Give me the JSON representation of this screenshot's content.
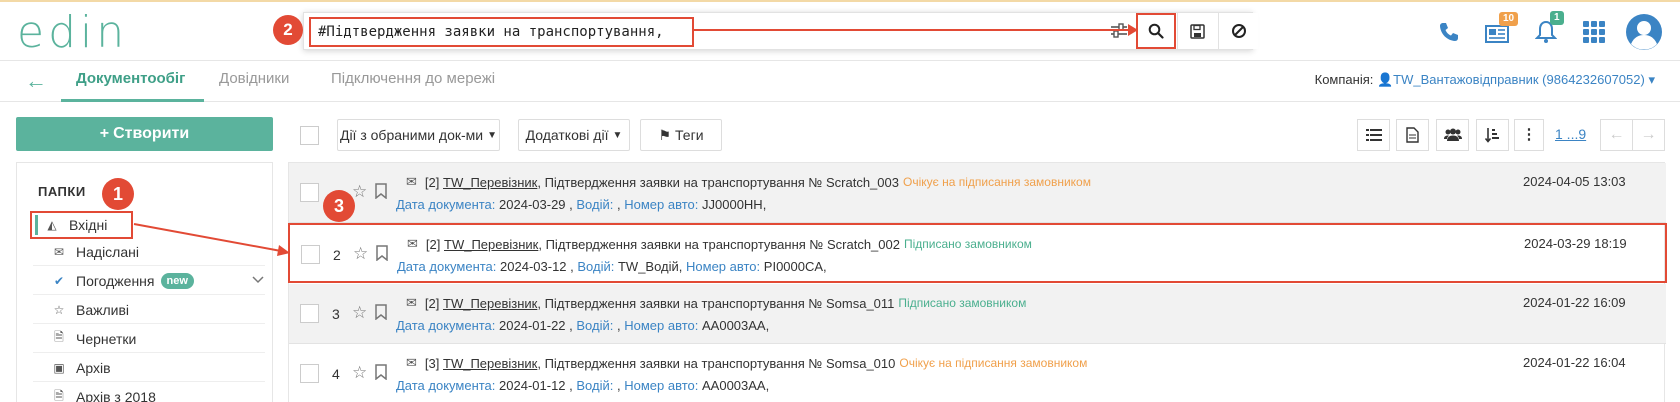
{
  "app": {
    "logo_text": "edin"
  },
  "search": {
    "value": "#Підтвердження заявки на транспортування,"
  },
  "header": {
    "notifications_count": "10",
    "alerts_count": "1"
  },
  "nav": {
    "tabs": [
      {
        "label": "Документообіг"
      },
      {
        "label": "Довідники"
      },
      {
        "label": "Підключення до мережі"
      }
    ],
    "company_label": "Компанія:",
    "company_value": "TW_Вантажовідправник (9864232607052)"
  },
  "sidebar": {
    "create_label": "Створити",
    "folders_title": "ПАПКИ",
    "items": [
      {
        "label": "Вхідні",
        "icon": "inbox-icon"
      },
      {
        "label": "Надіслані",
        "icon": "envelope-icon"
      },
      {
        "label": "Погодження",
        "icon": "check-icon",
        "badge": "new"
      },
      {
        "label": "Важливі",
        "icon": "star-icon"
      },
      {
        "label": "Чернетки",
        "icon": "file-icon"
      },
      {
        "label": "Архів",
        "icon": "archive-icon"
      },
      {
        "label": "Архів з 2018",
        "icon": "file-icon"
      }
    ]
  },
  "toolbar": {
    "actions_label": "Дії з обраними док-ми",
    "extra_label": "Додаткові дії",
    "tags_label": "Теги",
    "pager": "1 ...9"
  },
  "annotations": {
    "step1": "1",
    "step2": "2",
    "step3": "3"
  },
  "documents": [
    {
      "num": "",
      "count": "[2]",
      "sender": "TW_Перевізник",
      "title": ", Підтвердження заявки на транспортування № Scratch_003",
      "status": "Очікує на підписання замовником",
      "status_type": "orange",
      "doc_date_label": "Дата документа:",
      "doc_date": "2024-03-29 ,",
      "driver_label": "Водій:",
      "driver": ",",
      "car_label": "Номер авто:",
      "car": "JJ0000HH,",
      "date": "2024-04-05 13:03"
    },
    {
      "num": "2",
      "count": "[2]",
      "sender": "TW_Перевізник",
      "title": ", Підтвердження заявки на транспортування № Scratch_002",
      "status": "Підписано замовником",
      "status_type": "green",
      "doc_date_label": "Дата документа:",
      "doc_date": "2024-03-12 ,",
      "driver_label": "Водій:",
      "driver": "TW_Водій,",
      "car_label": "Номер авто:",
      "car": "PI0000CA,",
      "date": "2024-03-29 18:19"
    },
    {
      "num": "3",
      "count": "[2]",
      "sender": "TW_Перевізник",
      "title": ", Підтвердження заявки на транспортування № Somsa_011",
      "status": "Підписано замовником",
      "status_type": "green",
      "doc_date_label": "Дата документа:",
      "doc_date": "2024-01-22 ,",
      "driver_label": "Водій:",
      "driver": ",",
      "car_label": "Номер авто:",
      "car": "AA0003AA,",
      "date": "2024-01-22 16:09"
    },
    {
      "num": "4",
      "count": "[3]",
      "sender": "TW_Перевізник",
      "title": ", Підтвердження заявки на транспортування № Somsa_010",
      "status": "Очікує на підписання замовником",
      "status_type": "orange",
      "doc_date_label": "Дата документа:",
      "doc_date": "2024-01-12 ,",
      "driver_label": "Водій:",
      "driver": ",",
      "car_label": "Номер авто:",
      "car": "AA0003AA,",
      "date": "2024-01-22 16:04"
    }
  ]
}
